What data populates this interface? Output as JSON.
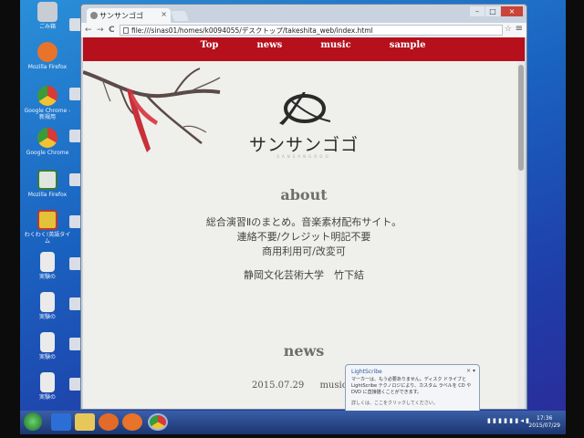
{
  "desktop": {
    "icons": [
      {
        "label": "ごみ箱",
        "color": "#c8ccd4"
      },
      {
        "label": "Mozilla Firefox",
        "color": "#e8732a"
      },
      {
        "label": "Google Chrome - 新規用",
        "color": "#d83a34"
      },
      {
        "label": "Google Chrome",
        "color": "#3b9a3b"
      },
      {
        "label": "Mozilla Firefox",
        "color": "#8cbf5a"
      },
      {
        "label": "わくわく!英語タイム",
        "color": "#e3c23a"
      },
      {
        "label": "実験の",
        "color": "#eaeaea"
      },
      {
        "label": "実験の",
        "color": "#eaeaea"
      },
      {
        "label": "実験の",
        "color": "#eaeaea"
      },
      {
        "label": "実験の",
        "color": "#eaeaea"
      }
    ]
  },
  "browser": {
    "tab_title": "サンサンゴゴ",
    "tab_close": "×",
    "url": "file:///sinas01/homes/k0094055/デスクトップ/takeshita_web/index.html",
    "back": "←",
    "forward": "→",
    "reload": "C",
    "star": "☆",
    "menu": "≡",
    "win_min": "–",
    "win_max": "□",
    "win_close": "×"
  },
  "site": {
    "nav": [
      "Top",
      "news",
      "music",
      "sample"
    ],
    "title": "サンサンゴゴ",
    "subtitle": "SANSANGOGO",
    "about": {
      "heading": "about",
      "lines": [
        "総合演習Ⅱのまとめ。音楽素材配布サイト。",
        "連絡不要/クレジット明記不要",
        "商用利用可/改変可"
      ],
      "author": "静岡文化芸術大学　竹下結"
    },
    "news": {
      "heading": "news",
      "date": "2015.07.29",
      "text": "music+6"
    },
    "colors": {
      "nav_bg": "#b5101c",
      "page_bg": "#efefeb"
    }
  },
  "balloon": {
    "title": "LightScribe",
    "body": "マーカーは、もう必要ありません。ディスク ドライブと LightScribe テクノロジにより、カスタム ラベルを CD や DVD に直接描くことができます。",
    "link": "詳しくは、ここをクリックしてください。",
    "close": "× ▾"
  },
  "taskbar": {
    "clock_time": "17:36",
    "clock_date": "2015/07/29"
  }
}
